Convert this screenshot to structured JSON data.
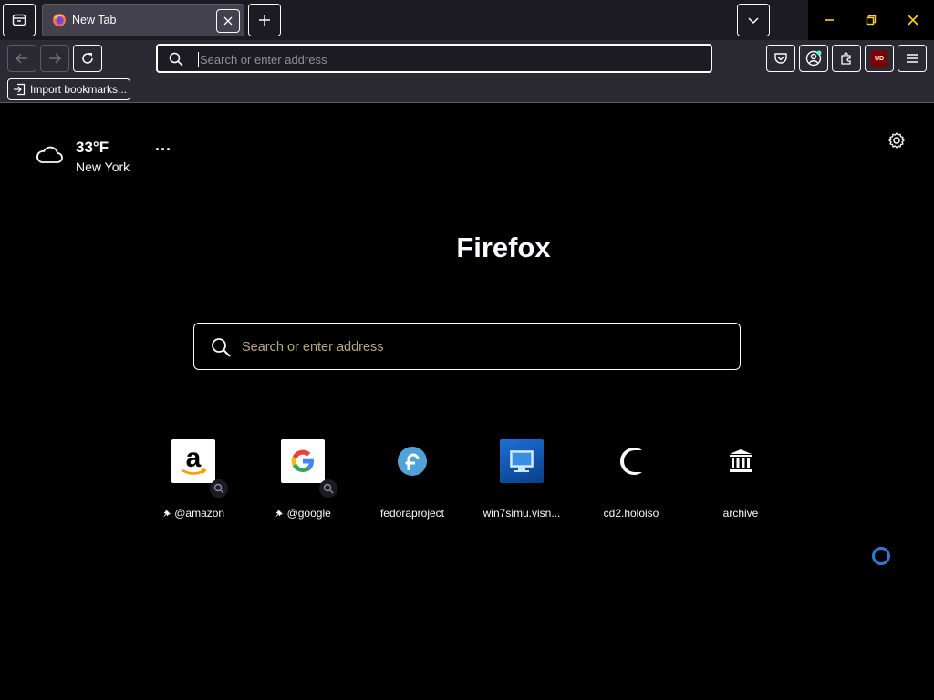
{
  "browser": {
    "tab": {
      "title": "New Tab"
    },
    "urlbar": {
      "placeholder": "Search or enter address"
    },
    "bookmarks": {
      "import_label": "Import bookmarks..."
    },
    "extension_badge": "UD"
  },
  "newtab": {
    "weather": {
      "temperature": "33°F",
      "city": "New York",
      "menu_label": "···"
    },
    "brand": "Firefox",
    "search": {
      "placeholder": "Search or enter address"
    },
    "shortcuts": [
      {
        "label": "@amazon",
        "icon": "amazon-icon"
      },
      {
        "label": "@google",
        "icon": "google-icon"
      },
      {
        "label": "fedoraproject",
        "icon": "fedora-icon"
      },
      {
        "label": "win7simu.visn...",
        "icon": "win7-icon"
      },
      {
        "label": "cd2.holoiso",
        "icon": "holoiso-icon"
      },
      {
        "label": "archive",
        "icon": "archive-icon"
      }
    ]
  },
  "colors": {
    "toolbar": "#2b2a33",
    "tabstrip": "#1c1b22",
    "page_bg": "#000000",
    "text": "#fbfbfe",
    "close_accent": "#ffd400",
    "spinner": "#2b7ad6"
  }
}
